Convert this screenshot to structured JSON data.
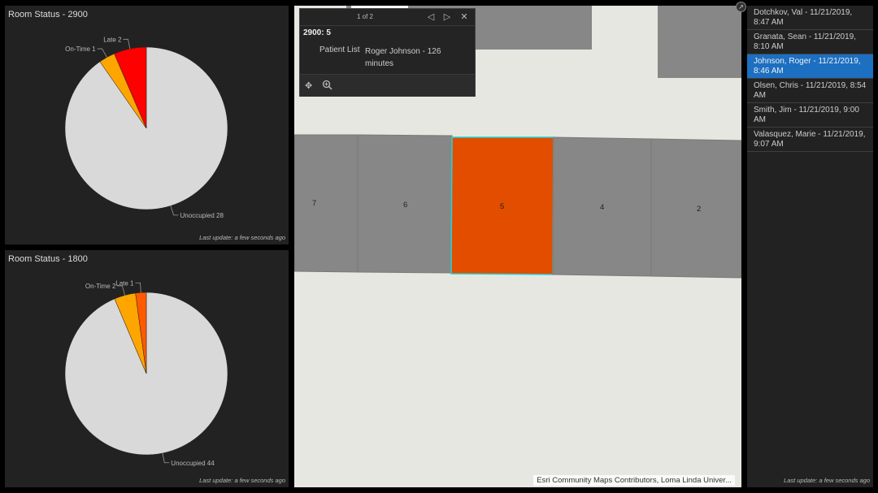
{
  "charts": [
    {
      "title": "Room Status - 2900",
      "last_update": "Last update: a few seconds ago",
      "chart_data": {
        "type": "pie",
        "slices": [
          {
            "label": "Unoccupied 28",
            "value": 28,
            "color": "#d9d9d9"
          },
          {
            "label": "On-Time 1",
            "value": 1,
            "color": "#ffa500"
          },
          {
            "label": "Late 2",
            "value": 2,
            "color": "#ff0000"
          }
        ]
      }
    },
    {
      "title": "Room Status - 1800",
      "last_update": "Last update: a few seconds ago",
      "chart_data": {
        "type": "pie",
        "slices": [
          {
            "label": "Unoccupied 44",
            "value": 44,
            "color": "#d9d9d9"
          },
          {
            "label": "On-Time 2",
            "value": 2,
            "color": "#ffa500"
          },
          {
            "label": "Late 1",
            "value": 1,
            "color": "#ff5a00"
          }
        ]
      }
    }
  ],
  "map": {
    "rooms": [
      "7",
      "6",
      "5",
      "4",
      "2"
    ],
    "selected_room": "5",
    "attribution": "Esri Community Maps Contributors, Loma Linda Univer...",
    "colors": {
      "room": "#878787",
      "selected": "#e24d00",
      "highlight": "#22d3d3",
      "background": "#e7e7e2"
    }
  },
  "popup": {
    "pager": "1 of 2",
    "title": "2900: 5",
    "field_label": "Patient List",
    "field_value": "Roger Johnson - 126 minutes"
  },
  "patient_list": {
    "items": [
      "Dotchkov, Val - 11/21/2019, 8:47 AM",
      "Granata, Sean - 11/21/2019, 8:10 AM",
      "Johnson, Roger - 11/21/2019, 8:46 AM",
      "Olsen, Chris - 11/21/2019, 8:54 AM",
      "Smith, Jim - 11/21/2019, 9:00 AM",
      "Valasquez, Marie - 11/21/2019, 9:07 AM"
    ],
    "selected_index": 2,
    "last_update": "Last update: a few seconds ago"
  }
}
